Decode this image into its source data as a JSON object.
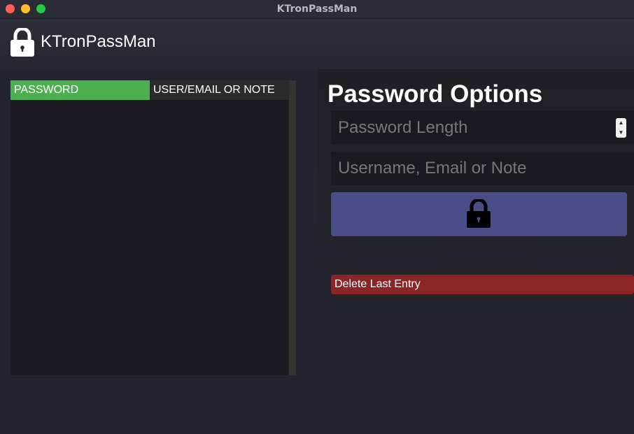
{
  "window": {
    "title": "KTronPassMan"
  },
  "header": {
    "app_name": "KTronPassMan",
    "logo_icon": "lock-icon"
  },
  "table": {
    "columns": [
      "PASSWORD",
      "USER/EMAIL OR NOTE"
    ],
    "rows": []
  },
  "options": {
    "title": "Password Options",
    "length_placeholder": "Password Length",
    "user_placeholder": "Username, Email or Note",
    "generate_icon": "lock-icon",
    "delete_label": "Delete Last Entry"
  },
  "colors": {
    "accent_green": "#4caf50",
    "generate_button": "#4a4d87",
    "delete_button": "#8b2528",
    "background": "#24242e"
  }
}
